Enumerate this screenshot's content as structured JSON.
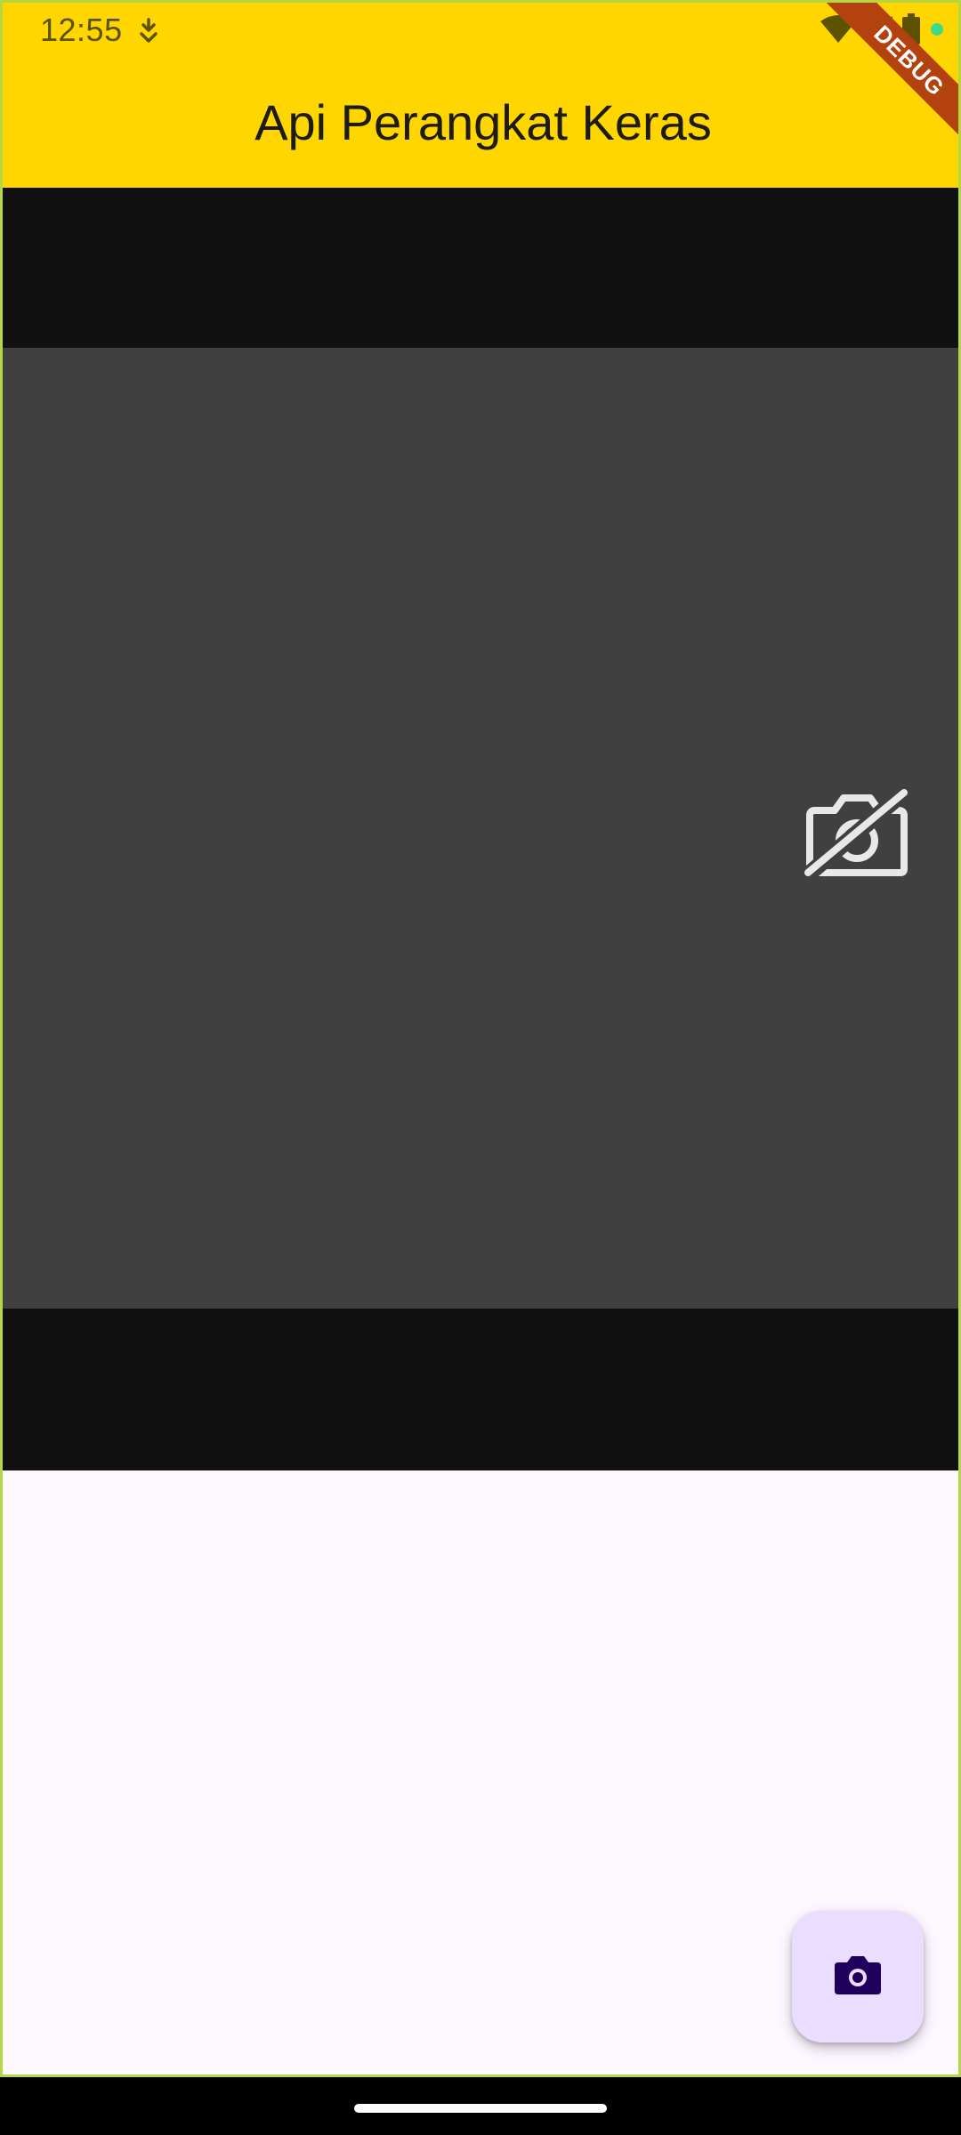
{
  "status_bar": {
    "time": "12:55",
    "icons": [
      "download-status-icon",
      "wifi-icon",
      "cell-signal-icon",
      "battery-icon",
      "privacy-dot-icon"
    ]
  },
  "app_bar": {
    "title": "Api Perangkat Keras",
    "background": "#ffd600"
  },
  "debug_banner": {
    "label": "DEBUG",
    "color": "#b3420f"
  },
  "camera": {
    "state_icon": "camera-off-icon",
    "preview_color": "#404040",
    "letterbox_color": "#111111"
  },
  "fab": {
    "icon": "camera-icon",
    "background": "#eaddff",
    "icon_color": "#21005d"
  },
  "colors": {
    "surface": "#fdf7ff",
    "frame_outline": "#b5d742"
  }
}
